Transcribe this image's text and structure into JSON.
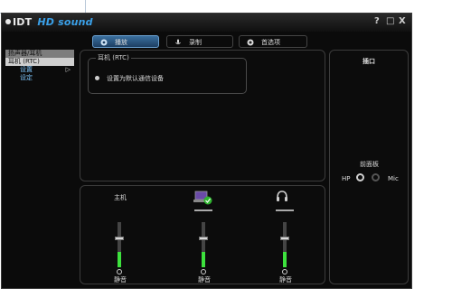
{
  "app": {
    "brand": "IDT",
    "product": "HD sound"
  },
  "titlebar": {
    "help": "?",
    "minimize": "□",
    "close": "X"
  },
  "tabs": [
    {
      "label": "播放",
      "icon": "speaker-icon",
      "active": true
    },
    {
      "label": "录制",
      "icon": "mic-icon",
      "active": false
    },
    {
      "label": "首选项",
      "icon": "gear-icon",
      "active": false
    }
  ],
  "sidebar": {
    "items": [
      {
        "label": "扬声器/耳机"
      },
      {
        "label": "耳机 (RTC)"
      },
      {
        "label": "设置"
      },
      {
        "label": "设定"
      }
    ],
    "arrow": "▷"
  },
  "device_panel": {
    "group_title": "耳机 (RTC)",
    "option": "设置为默认通信设备"
  },
  "jack_panel": {
    "title": "插口",
    "front_label": "前面板",
    "hp_label": "HP",
    "mic_label": "Mic"
  },
  "mixer": {
    "channels": [
      {
        "label": "主机",
        "mute_label": "静音",
        "level": 0.35
      },
      {
        "label": "",
        "mute_label": "静音",
        "level": 0.35
      },
      {
        "label": "",
        "mute_label": "静音",
        "level": 0.35
      }
    ]
  },
  "colors": {
    "accent": "#3aa0e8",
    "level": "#3de13d",
    "background": "#0b0b0b"
  }
}
